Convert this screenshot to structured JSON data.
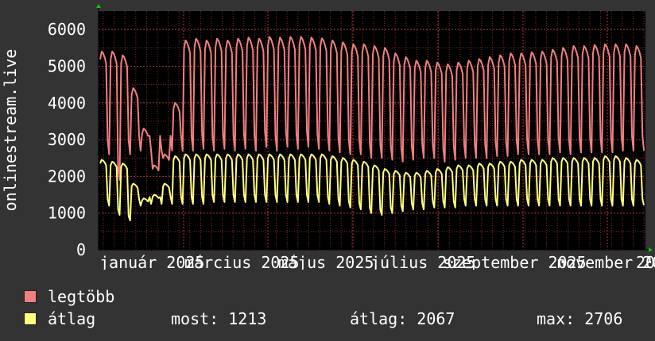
{
  "chart_data": {
    "type": "line",
    "ylabel": "onlinestream.live",
    "ylim": [
      0,
      6500
    ],
    "yticks": [
      0,
      1000,
      2000,
      3000,
      4000,
      5000,
      6000
    ],
    "x_tick_labels": [
      "január 2025",
      "március 2025",
      "május 2025",
      "július 2025",
      "szeptember 2025",
      "november 2025"
    ],
    "x_tick_label_last_partial": "20",
    "grid": true,
    "colors": {
      "legtobb": "#f08080",
      "atlag": "#ffff80",
      "grid": "#7a2e2e",
      "axis": "#000000"
    },
    "series": [
      {
        "name": "legtöbb",
        "pattern": "weekly",
        "weekday_peak": [
          5400,
          5400,
          5300,
          4400,
          3300,
          2300,
          2600,
          4000,
          5700,
          5750,
          5700,
          5750,
          5700,
          5750,
          5780,
          5750,
          5800,
          5780,
          5800,
          5800,
          5780,
          5760,
          5700,
          5650,
          5600,
          5600,
          5550,
          5500,
          5350,
          5250,
          5150,
          5150,
          5100,
          5050,
          5100,
          5150,
          5200,
          5250,
          5300,
          5350,
          5350,
          5380,
          5400,
          5450,
          5500,
          5550,
          5550,
          5580,
          5600,
          5600,
          5600,
          5550,
          5350
        ],
        "weekend_low": [
          2600,
          1900,
          2600,
          2700,
          2700,
          2700,
          2700,
          2700,
          2700,
          2750,
          2700,
          2750,
          2700,
          2750,
          2700,
          2800,
          2700,
          2800,
          2750,
          2800,
          2750,
          2700,
          2650,
          2600,
          2600,
          2500,
          2500,
          2450,
          2400,
          2450,
          2500,
          2500,
          2400,
          2450,
          2500,
          2500,
          2500,
          2550,
          2550,
          2600,
          2600,
          2600,
          2600,
          2650,
          2600,
          2650,
          2650,
          2650,
          2650,
          2700,
          2700,
          2700
        ]
      },
      {
        "name": "átlag",
        "pattern": "weekly",
        "weekday_peak": [
          2450,
          2400,
          2350,
          1800,
          1400,
          1500,
          1800,
          2550,
          2600,
          2600,
          2600,
          2600,
          2600,
          2600,
          2600,
          2600,
          2600,
          2600,
          2600,
          2600,
          2600,
          2600,
          2550,
          2500,
          2450,
          2400,
          2300,
          2200,
          2150,
          2100,
          2100,
          2150,
          2200,
          2250,
          2300,
          2300,
          2350,
          2350,
          2400,
          2400,
          2450,
          2450,
          2450,
          2500,
          2500,
          2500,
          2500,
          2500,
          2550,
          2550,
          2500,
          2450
        ],
        "weekend_low": [
          1200,
          950,
          800,
          1200,
          1250,
          1250,
          1250,
          1250,
          1250,
          1250,
          1300,
          1300,
          1300,
          1300,
          1300,
          1300,
          1300,
          1300,
          1300,
          1300,
          1300,
          1250,
          1200,
          1150,
          1100,
          1000,
          950,
          1000,
          1050,
          1100,
          1100,
          1150,
          1150,
          1150,
          1200,
          1200,
          1200,
          1200,
          1200,
          1200,
          1200,
          1200,
          1200,
          1200,
          1200,
          1200,
          1200,
          1200,
          1200,
          1200,
          1200,
          1200
        ],
        "last_value": 1213
      }
    ]
  },
  "legend": {
    "items": [
      {
        "label": "legtöbb",
        "color": "#f08080"
      },
      {
        "label": "átlag",
        "color": "#ffff80"
      }
    ],
    "stats": {
      "most": "most: 1213",
      "atlag": "átlag: 2067",
      "max": "max: 2706"
    }
  }
}
